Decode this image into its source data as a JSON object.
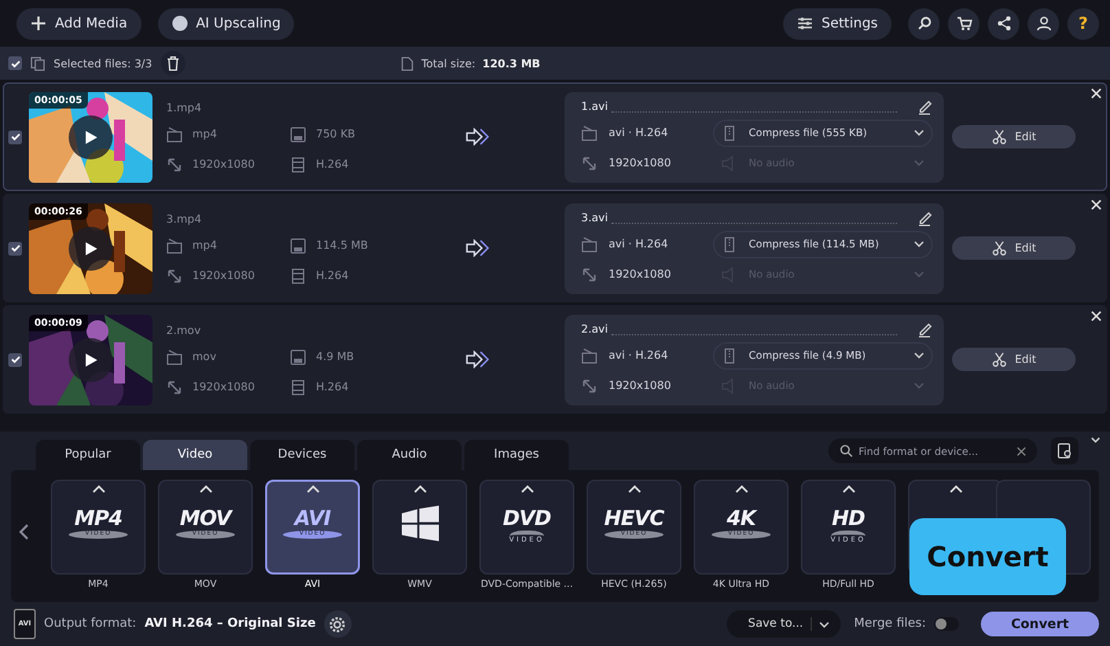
{
  "toolbar": {
    "add_media": "Add Media",
    "ai_upscaling": "AI Upscaling",
    "settings": "Settings",
    "help": "?"
  },
  "selection_bar": {
    "all_checked": true,
    "selected_files": "Selected files: 3/3",
    "total_size_label": "Total size:",
    "total_size": "120.3 MB"
  },
  "files": [
    {
      "checked": true,
      "duration": "00:00:05",
      "name": "1.mp4",
      "container": "mp4",
      "size": "750 KB",
      "resolution": "1920x1080",
      "codec": "H.264",
      "output": {
        "name": "1.avi",
        "codec": "avi · H.264",
        "resolution": "1920x1080",
        "compress": "Compress file (555 KB)",
        "audio": "No audio",
        "audio_disabled": true
      },
      "edit": "Edit"
    },
    {
      "checked": true,
      "duration": "00:00:26",
      "name": "3.mp4",
      "container": "mp4",
      "size": "114.5 MB",
      "resolution": "1920x1080",
      "codec": "H.264",
      "output": {
        "name": "3.avi",
        "codec": "avi · H.264",
        "resolution": "1920x1080",
        "compress": "Compress file (114.5 MB)",
        "audio": "No audio",
        "audio_disabled": true
      },
      "edit": "Edit"
    },
    {
      "checked": true,
      "duration": "00:00:09",
      "name": "2.mov",
      "container": "mov",
      "size": "4.9 MB",
      "resolution": "1920x1080",
      "codec": "H.264",
      "output": {
        "name": "2.avi",
        "codec": "avi · H.264",
        "resolution": "1920x1080",
        "compress": "Compress file (4.9 MB)",
        "audio": "No audio",
        "audio_disabled": true
      },
      "edit": "Edit"
    }
  ],
  "format_tabs": [
    {
      "label": "Popular",
      "selected": false
    },
    {
      "label": "Video",
      "selected": true
    },
    {
      "label": "Devices",
      "selected": false
    },
    {
      "label": "Audio",
      "selected": false
    },
    {
      "label": "Images",
      "selected": false
    }
  ],
  "format_search": {
    "placeholder": "Find format or device..."
  },
  "formats": [
    {
      "kind": "logo",
      "logo": "MP4",
      "sub": "VIDEO",
      "label": "MP4",
      "selected": false
    },
    {
      "kind": "logo",
      "logo": "MOV",
      "sub": "VIDEO",
      "label": "MOV",
      "selected": false
    },
    {
      "kind": "logo",
      "logo": "AVI",
      "sub": "VIDEO",
      "label": "AVI",
      "selected": true
    },
    {
      "kind": "windows",
      "label": "WMV",
      "selected": false
    },
    {
      "kind": "disc",
      "logo": "DVD",
      "sub": "VIDEO",
      "label": "DVD-Compatible ...",
      "selected": false
    },
    {
      "kind": "logo",
      "logo": "HEVC",
      "sub": "VIDEO",
      "label": "HEVC (H.265)",
      "selected": false
    },
    {
      "kind": "logo",
      "logo": "4K",
      "sub": "VIDEO",
      "label": "4K Ultra HD",
      "selected": false
    },
    {
      "kind": "disc",
      "logo": "HD",
      "sub": "VIDEO",
      "label": "HD/Full HD",
      "selected": false
    }
  ],
  "footer": {
    "output_label": "Output format:",
    "output_value": "AVI H.264 – Original Size",
    "format_badge": "AVI",
    "save_to": "Save to...",
    "merge_label": "Merge files:",
    "merge_on": false,
    "convert": "Convert"
  },
  "tooltip": "Convert"
}
